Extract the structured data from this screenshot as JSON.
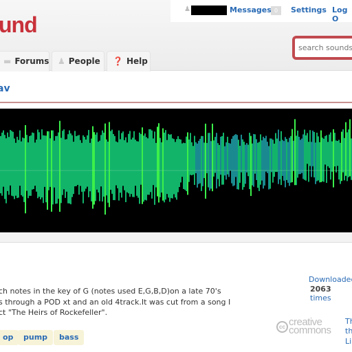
{
  "header": {
    "logo_text": "und",
    "username_redacted": true,
    "messages_label": "Messages",
    "messages_count": "0",
    "settings_label": "Settings",
    "logout_label": "Log O",
    "tabs": [
      {
        "label": "Forums",
        "icon": "speech-bubble-icon"
      },
      {
        "label": "People",
        "icon": "people-icon"
      },
      {
        "label": "Help",
        "icon": "help-icon"
      }
    ],
    "search_placeholder": "search sounds"
  },
  "sound": {
    "title": "av",
    "description": [
      "ch notes in the key of G (notes used E,G,B,D)on a late 70's",
      "s through a POD xt and an old 4track.It was cut from a song I",
      "ct \"The Heirs of Rockefeller\"."
    ],
    "tags": [
      "op",
      "pump",
      "bass"
    ],
    "downloaded_label": "Downloaded",
    "download_count": "2063",
    "times_label": "times",
    "license_logo": {
      "c1": "cc",
      "c2": "creative",
      "c3": "commons"
    },
    "license_text": [
      "Th",
      "th",
      "Li"
    ]
  },
  "colors": {
    "brand": "#c8313a",
    "link": "#2a6bb5",
    "waveform_bg": "#000000",
    "waveform_green": "#1fd060",
    "waveform_teal": "#1a8a8a"
  }
}
